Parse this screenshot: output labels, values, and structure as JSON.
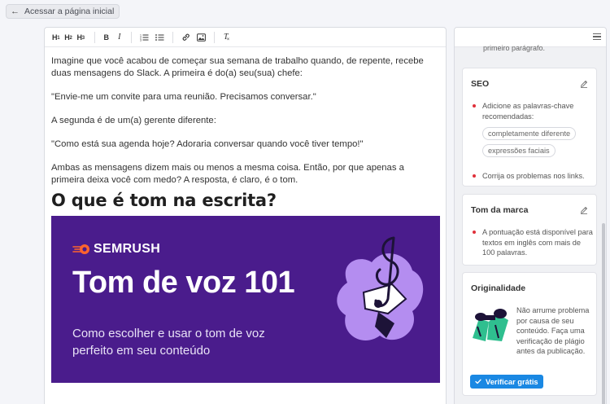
{
  "back_button": {
    "label": "Acessar a página inicial"
  },
  "toolbar": {
    "h1": "H",
    "h1_sub": "1",
    "h2": "H",
    "h2_sub": "2",
    "h3": "H",
    "h3_sub": "3",
    "bold": "B",
    "italic": "I",
    "clear": "T"
  },
  "content": {
    "paragraphs": [
      "Imagine que você acabou de começar sua semana de trabalho quando, de repente, recebe duas mensagens do Slack. A primeira é do(a) seu(sua) chefe:",
      "\"Envie-me um convite para uma reunião. Precisamos conversar.\"",
      "A segunda é de um(a) gerente diferente:",
      "\"Como está sua agenda hoje? Adoraria conversar quando você tiver tempo!\"",
      "Ambas as mensagens dizem mais ou menos a mesma coisa. Então, por que apenas a primeira deixa você com medo? A resposta, é claro, é o tom."
    ],
    "heading": "O que é tom na escrita?",
    "banner": {
      "logo": "SEMRUSH",
      "title": "Tom de voz 101",
      "subtitle": "Como escolher e usar o tom de voz perfeito em seu conteúdo",
      "bg_color": "#4a1c8c",
      "accent_color": "#ff642d"
    }
  },
  "sidebar": {
    "previous_text": "primeiro parágrafo.",
    "seo": {
      "title": "SEO",
      "item1": "Adicione as palavras-chave recomendadas:",
      "keywords": [
        "completamente diferente",
        "expressões faciais"
      ],
      "item2": "Corrija os problemas nos links."
    },
    "brand": {
      "title": "Tom da marca",
      "item": "A pontuação está disponível para textos em inglês com mais de 100 palavras."
    },
    "originality": {
      "title": "Originalidade",
      "text": "Não arrume problema por causa de seu conteúdo. Faça uma verificação de plágio antes da publicação.",
      "button": "Verificar grátis"
    }
  }
}
